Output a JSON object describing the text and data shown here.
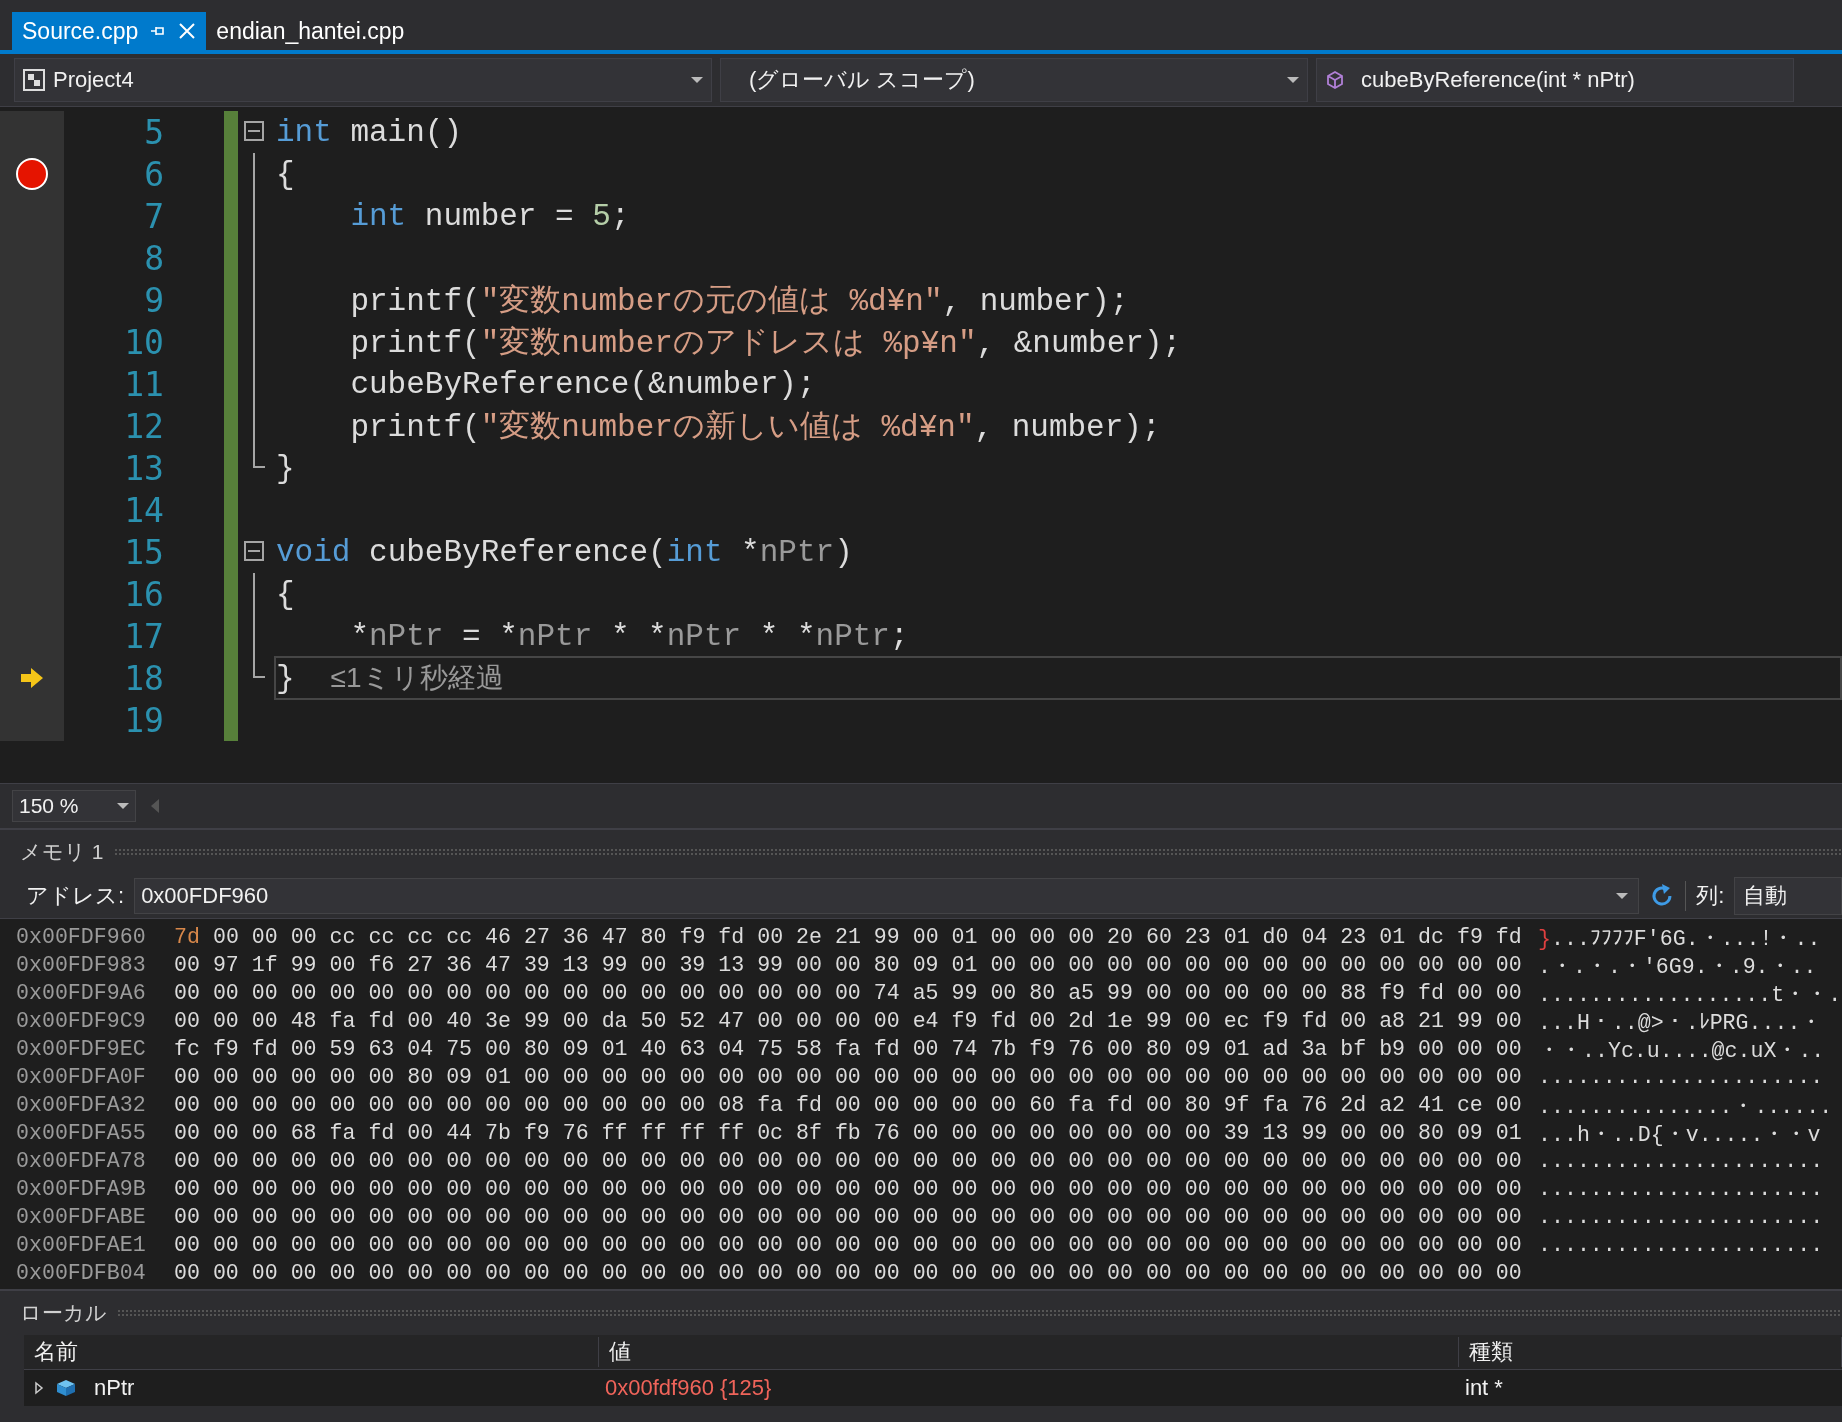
{
  "tabs": [
    {
      "label": "Source.cpp",
      "selected": true
    },
    {
      "label": "endian_hantei.cpp",
      "selected": false
    }
  ],
  "navigation": {
    "project": "Project4",
    "scope": "(グローバル スコープ)",
    "member": "cubeByReference(int * nPtr)"
  },
  "code_lines": [
    {
      "number": "5",
      "fold_start": true,
      "fold_guide": false,
      "fold_end": false,
      "breakpoint": false,
      "current": false,
      "tokens": [
        {
          "kind": "keyword",
          "text": "int"
        },
        {
          "kind": "plain",
          "text": " main()"
        }
      ]
    },
    {
      "number": "6",
      "fold_start": false,
      "fold_guide": true,
      "fold_end": false,
      "breakpoint": true,
      "current": false,
      "tokens": [
        {
          "kind": "plain",
          "text": "{"
        }
      ]
    },
    {
      "number": "7",
      "fold_start": false,
      "fold_guide": true,
      "fold_end": false,
      "breakpoint": false,
      "current": false,
      "tokens": [
        {
          "kind": "keyword",
          "text": "    int"
        },
        {
          "kind": "plain",
          "text": " number = "
        },
        {
          "kind": "number",
          "text": "5"
        },
        {
          "kind": "plain",
          "text": ";"
        }
      ]
    },
    {
      "number": "8",
      "fold_start": false,
      "fold_guide": true,
      "fold_end": false,
      "breakpoint": false,
      "current": false
    },
    {
      "number": "9",
      "fold_start": false,
      "fold_guide": true,
      "fold_end": false,
      "breakpoint": false,
      "current": false,
      "tokens": [
        {
          "kind": "plain",
          "text": "    printf("
        },
        {
          "kind": "string",
          "text": "\"変数numberの元の値は %d¥n\""
        },
        {
          "kind": "plain",
          "text": ", number);"
        }
      ]
    },
    {
      "number": "10",
      "fold_start": false,
      "fold_guide": true,
      "fold_end": false,
      "breakpoint": false,
      "current": false,
      "tokens": [
        {
          "kind": "plain",
          "text": "    printf("
        },
        {
          "kind": "string",
          "text": "\"変数numberのアドレスは %p¥n\""
        },
        {
          "kind": "plain",
          "text": ", &number);"
        }
      ]
    },
    {
      "number": "11",
      "fold_start": false,
      "fold_guide": true,
      "fold_end": false,
      "breakpoint": false,
      "current": false,
      "tokens": [
        {
          "kind": "plain",
          "text": "    cubeByReference(&number);"
        }
      ]
    },
    {
      "number": "12",
      "fold_start": false,
      "fold_guide": true,
      "fold_end": false,
      "breakpoint": false,
      "current": false,
      "tokens": [
        {
          "kind": "plain",
          "text": "    printf("
        },
        {
          "kind": "string",
          "text": "\"変数numberの新しい値は %d¥n\""
        },
        {
          "kind": "plain",
          "text": ", number);"
        }
      ]
    },
    {
      "number": "13",
      "fold_start": false,
      "fold_guide": true,
      "fold_end": true,
      "breakpoint": false,
      "current": false,
      "tokens": [
        {
          "kind": "plain",
          "text": "}"
        }
      ]
    },
    {
      "number": "14",
      "fold_start": false,
      "fold_guide": false,
      "fold_end": false,
      "breakpoint": false,
      "current": false
    },
    {
      "number": "15",
      "fold_start": true,
      "fold_guide": false,
      "fold_end": false,
      "breakpoint": false,
      "current": false,
      "tokens": [
        {
          "kind": "keyword",
          "text": "void"
        },
        {
          "kind": "plain",
          "text": " cubeByReference("
        },
        {
          "kind": "keyword",
          "text": "int"
        },
        {
          "kind": "plain",
          "text": " *"
        },
        {
          "kind": "param",
          "text": "nPtr"
        },
        {
          "kind": "plain",
          "text": ")"
        }
      ]
    },
    {
      "number": "16",
      "fold_start": false,
      "fold_guide": true,
      "fold_end": false,
      "breakpoint": false,
      "current": false,
      "tokens": [
        {
          "kind": "plain",
          "text": "{"
        }
      ]
    },
    {
      "number": "17",
      "fold_start": false,
      "fold_guide": true,
      "fold_end": false,
      "breakpoint": false,
      "current": false,
      "tokens": [
        {
          "kind": "plain",
          "text": "    *"
        },
        {
          "kind": "param",
          "text": "nPtr"
        },
        {
          "kind": "plain",
          "text": " = *"
        },
        {
          "kind": "param",
          "text": "nPtr"
        },
        {
          "kind": "plain",
          "text": " * *"
        },
        {
          "kind": "param",
          "text": "nPtr"
        },
        {
          "kind": "plain",
          "text": " * *"
        },
        {
          "kind": "param",
          "text": "nPtr"
        },
        {
          "kind": "plain",
          "text": ";"
        }
      ]
    },
    {
      "number": "18",
      "fold_start": false,
      "fold_guide": true,
      "fold_end": true,
      "breakpoint": false,
      "current": true,
      "hint": "≤1ミリ秒経過",
      "tokens": [
        {
          "kind": "plain",
          "text": "}"
        }
      ]
    },
    {
      "number": "19",
      "fold_start": false,
      "fold_guide": false,
      "fold_end": false,
      "breakpoint": false,
      "current": false
    }
  ],
  "zoom": "150 %",
  "memory": {
    "title": "メモリ 1",
    "address_label": "アドレス:",
    "address": "0x00FDF960",
    "columns_label": "列:",
    "columns": "自動",
    "rows": [
      {
        "address": "0x00FDF960",
        "changed": "7d",
        "bytes": "00 00 00 cc cc cc cc 46 27 36 47 80 f9 fd 00 2e 21 99 00 01 00 00 00 20 60 23 01 d0 04 23 01 dc f9 fd",
        "ascii_changed": "}",
        "ascii": "...ﾌﾌﾌﾌF'6G.・...!・.."
      },
      {
        "address": "0x00FDF983",
        "bytes": "00 97 1f 99 00 f6 27 36 47 39 13 99 00 39 13 99 00 00 80 09 01 00 00 00 00 00 00 00 00 00 00 00 00 00 00",
        "ascii": ".・.・.・'6G9.・.9.・.."
      },
      {
        "address": "0x00FDF9A6",
        "bytes": "00 00 00 00 00 00 00 00 00 00 00 00 00 00 00 00 00 00 74 a5 99 00 80 a5 99 00 00 00 00 00 88 f9 fd 00 00",
        "ascii": "..................t・・."
      },
      {
        "address": "0x00FDF9C9",
        "bytes": "00 00 00 48 fa fd 00 40 3e 99 00 da 50 52 47 00 00 00 00 e4 f9 fd 00 2d 1e 99 00 ec f9 fd 00 a8 21 99 00",
        "ascii": "...H・..@>・.ﾚPRG....・"
      },
      {
        "address": "0x00FDF9EC",
        "bytes": "fc f9 fd 00 59 63 04 75 00 80 09 01 40 63 04 75 58 fa fd 00 74 7b f9 76 00 80 09 01 ad 3a bf b9 00 00 00",
        "ascii": "・・..Yc.u....@c.uX・.."
      },
      {
        "address": "0x00FDFA0F",
        "bytes": "00 00 00 00 00 00 80 09 01 00 00 00 00 00 00 00 00 00 00 00 00 00 00 00 00 00 00 00 00 00 00 00 00 00 00",
        "ascii": "......................"
      },
      {
        "address": "0x00FDFA32",
        "bytes": "00 00 00 00 00 00 00 00 00 00 00 00 00 00 08 fa fd 00 00 00 00 00 60 fa fd 00 80 9f fa 76 2d a2 41 ce 00",
        "ascii": "...............・......"
      },
      {
        "address": "0x00FDFA55",
        "bytes": "00 00 00 68 fa fd 00 44 7b f9 76 ff ff ff ff 0c 8f fb 76 00 00 00 00 00 00 00 00 39 13 99 00 00 80 09 01",
        "ascii": "...h・..D{・v.....・・v"
      },
      {
        "address": "0x00FDFA78",
        "bytes": "00 00 00 00 00 00 00 00 00 00 00 00 00 00 00 00 00 00 00 00 00 00 00 00 00 00 00 00 00 00 00 00 00 00 00",
        "ascii": "......................"
      },
      {
        "address": "0x00FDFA9B",
        "bytes": "00 00 00 00 00 00 00 00 00 00 00 00 00 00 00 00 00 00 00 00 00 00 00 00 00 00 00 00 00 00 00 00 00 00 00",
        "ascii": "......................"
      },
      {
        "address": "0x00FDFABE",
        "bytes": "00 00 00 00 00 00 00 00 00 00 00 00 00 00 00 00 00 00 00 00 00 00 00 00 00 00 00 00 00 00 00 00 00 00 00",
        "ascii": "......................"
      },
      {
        "address": "0x00FDFAE1",
        "bytes": "00 00 00 00 00 00 00 00 00 00 00 00 00 00 00 00 00 00 00 00 00 00 00 00 00 00 00 00 00 00 00 00 00 00 00",
        "ascii": "......................"
      },
      {
        "address": "0x00FDFB04",
        "bytes": "00 00 00 00 00 00 00 00 00 00 00 00 00 00 00 00 00 00 00 00 00 00 00 00 00 00 00 00 00 00 00 00 00 00 00"
      }
    ]
  },
  "locals": {
    "title": "ローカル",
    "columns": [
      "名前",
      "値",
      "種類"
    ],
    "rows": [
      {
        "name": "nPtr",
        "value": "0x00fdf960 {125}",
        "type": "int *",
        "expanded": false
      }
    ]
  }
}
